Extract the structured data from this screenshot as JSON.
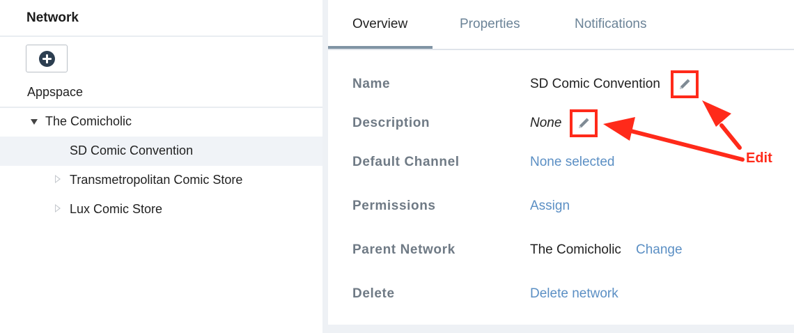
{
  "sidebar": {
    "title": "Network",
    "add_icon": "plus-circle-icon",
    "section_label": "Appspace",
    "tree": [
      {
        "label": "The Comicholic",
        "state": "expanded"
      },
      {
        "label": "SD Comic Convention",
        "state": "selected"
      },
      {
        "label": "Transmetropolitan Comic Store",
        "state": "collapsed"
      },
      {
        "label": "Lux Comic Store",
        "state": "collapsed"
      }
    ]
  },
  "tabs": [
    {
      "label": "Overview",
      "active": true
    },
    {
      "label": "Properties",
      "active": false
    },
    {
      "label": "Notifications",
      "active": false
    }
  ],
  "overview": {
    "name": {
      "label": "Name",
      "value": "SD Comic Convention"
    },
    "description": {
      "label": "Description",
      "value": "None"
    },
    "default_channel": {
      "label": "Default Channel",
      "link": "None selected"
    },
    "permissions": {
      "label": "Permissions",
      "link": "Assign"
    },
    "parent_network": {
      "label": "Parent Network",
      "value": "The Comicholic",
      "link": "Change"
    },
    "delete": {
      "label": "Delete",
      "link": "Delete network"
    }
  },
  "annotation": {
    "label": "Edit",
    "color": "#ff2a1a"
  },
  "colors": {
    "link": "#5b8fc4",
    "label": "#6f7a85",
    "tab_inactive": "#6b8397",
    "accent_red": "#ff2a1a"
  }
}
